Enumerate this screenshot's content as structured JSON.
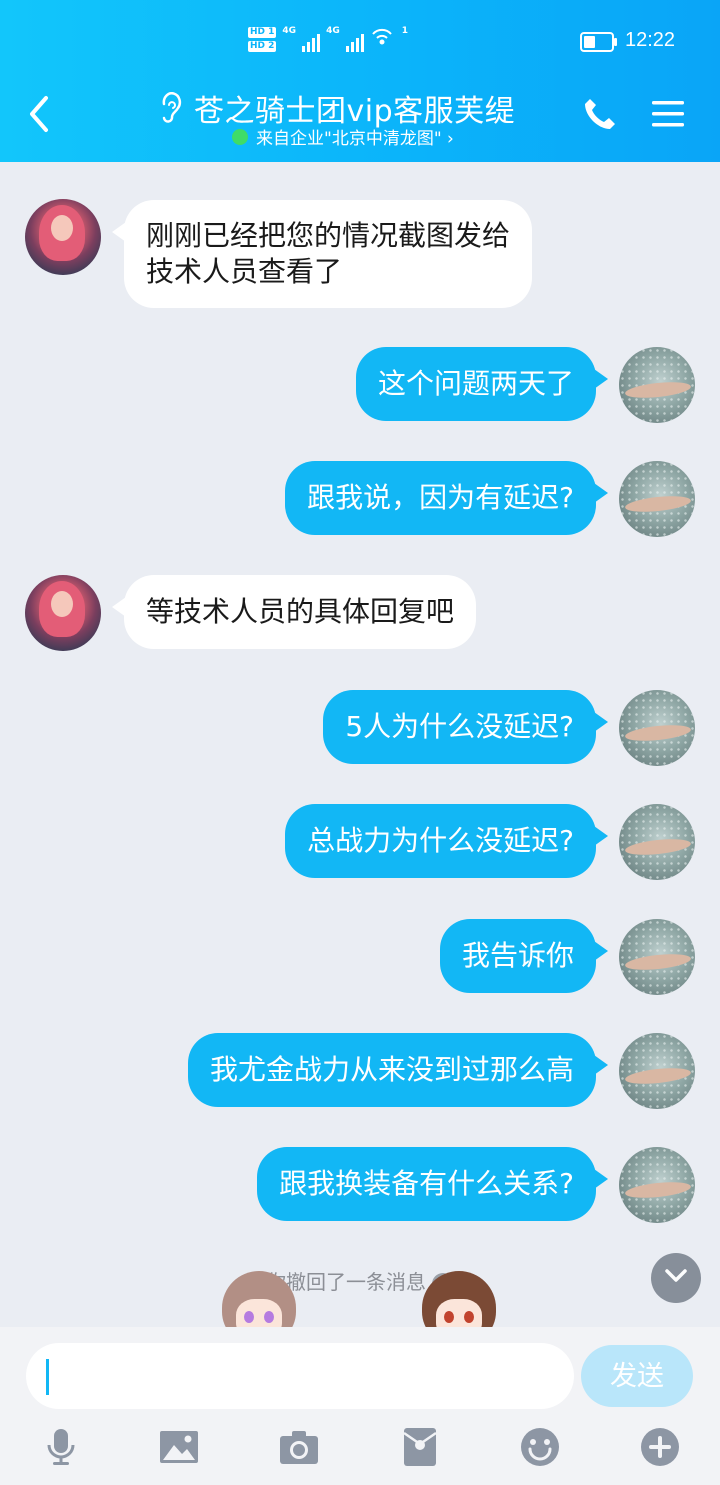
{
  "status_bar": {
    "hd_1": "HD 1",
    "hd_2": "HD 2",
    "net_1": "4G",
    "net_2": "4G",
    "wifi_badge": "1",
    "time": "12:22"
  },
  "header": {
    "title": "苍之骑士团vip客服芙缇",
    "subtitle": "来自企业\"北京中清龙图\" ›",
    "online_color": "#3fdc67",
    "accent_color": "#0bb4fa"
  },
  "messages": [
    {
      "side": "in",
      "text_line1": "刚刚已经把您的情况截图发给",
      "text_line2": "技术人员查看了"
    },
    {
      "side": "out",
      "text": "这个问题两天了"
    },
    {
      "side": "out",
      "text": "跟我说，因为有延迟?"
    },
    {
      "side": "in",
      "text": "等技术人员的具体回复吧"
    },
    {
      "side": "out",
      "text": "5人为什么没延迟?"
    },
    {
      "side": "out",
      "text": "总战力为什么没延迟?"
    },
    {
      "side": "out",
      "text": "我告诉你"
    },
    {
      "side": "out",
      "text": "我尤金战力从来没到过那么高"
    },
    {
      "side": "out",
      "text": "跟我换装备有什么关系?"
    }
  ],
  "recall_notice": "你撤回了一条消息",
  "input": {
    "value": "",
    "send_label": "发送"
  },
  "toolbar": {
    "icons": [
      "microphone-icon",
      "image-icon",
      "camera-icon",
      "red-packet-icon",
      "emoji-icon",
      "plus-icon"
    ]
  }
}
